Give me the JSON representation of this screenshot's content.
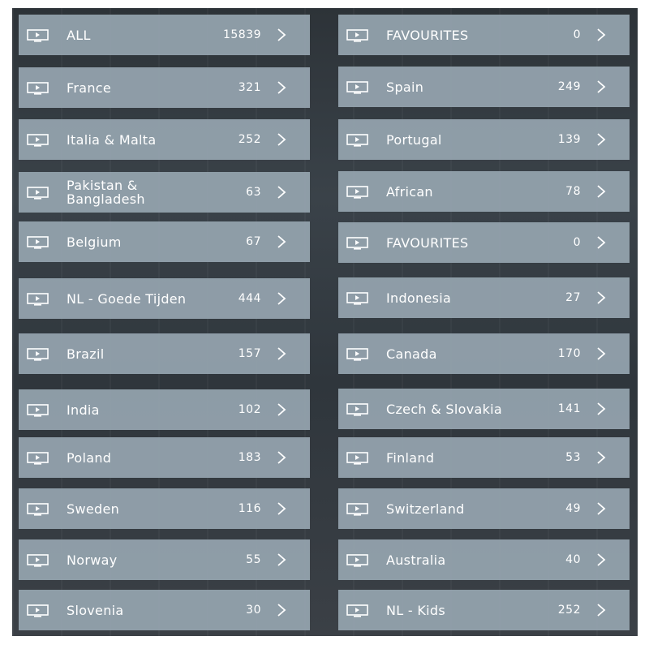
{
  "rows": [
    {
      "left": {
        "label": "ALL",
        "count": "15839",
        "icon": "tv-icon"
      },
      "right": {
        "label": "FAVOURITES",
        "count": "0",
        "icon": "tv-icon"
      }
    },
    {
      "left": {
        "label": "France",
        "count": "321",
        "icon": "tv-icon"
      },
      "right": {
        "label": "Spain",
        "count": "249",
        "icon": "tv-icon"
      }
    },
    {
      "left": {
        "label": "Italia & Malta",
        "count": "252",
        "icon": "tv-icon"
      },
      "right": {
        "label": "Portugal",
        "count": "139",
        "icon": "tv-icon"
      }
    },
    {
      "left": {
        "label": "Pakistan & Bangladesh",
        "count": "63",
        "icon": "tv-icon"
      },
      "right": {
        "label": "African",
        "count": "78",
        "icon": "tv-icon"
      }
    },
    {
      "left": {
        "label": "Belgium",
        "count": "67",
        "icon": "tv-icon"
      },
      "right": {
        "label": "FAVOURITES",
        "count": "0",
        "icon": "tv-icon"
      }
    },
    {
      "left": {
        "label": "NL - Goede Tijden",
        "count": "444",
        "icon": "tv-icon"
      },
      "right": {
        "label": "Indonesia",
        "count": "27",
        "icon": "tv-icon"
      }
    },
    {
      "left": {
        "label": "Brazil",
        "count": "157",
        "icon": "tv-icon"
      },
      "right": {
        "label": "Canada",
        "count": "170",
        "icon": "tv-icon"
      }
    },
    {
      "left": {
        "label": "India",
        "count": "102",
        "icon": "tv-icon"
      },
      "right": {
        "label": "Czech & Slovakia",
        "count": "141",
        "icon": "tv-icon"
      }
    },
    {
      "left": {
        "label": "Poland",
        "count": "183",
        "icon": "tv-icon"
      },
      "right": {
        "label": "Finland",
        "count": "53",
        "icon": "tv-icon"
      }
    },
    {
      "left": {
        "label": "Sweden",
        "count": "116",
        "icon": "tv-icon"
      },
      "right": {
        "label": "Switzerland",
        "count": "49",
        "icon": "tv-icon"
      }
    },
    {
      "left": {
        "label": "Norway",
        "count": "55",
        "icon": "tv-icon"
      },
      "right": {
        "label": "Australia",
        "count": "40",
        "icon": "tv-icon"
      }
    },
    {
      "left": {
        "label": "Slovenia",
        "count": "30",
        "icon": "tv-icon"
      },
      "right": {
        "label": "NL - Kids",
        "count": "252",
        "icon": "tv-icon"
      }
    }
  ],
  "colors": {
    "tile_background": "#96a5b0",
    "text": "#ffffff",
    "backdrop": "#343b41"
  }
}
